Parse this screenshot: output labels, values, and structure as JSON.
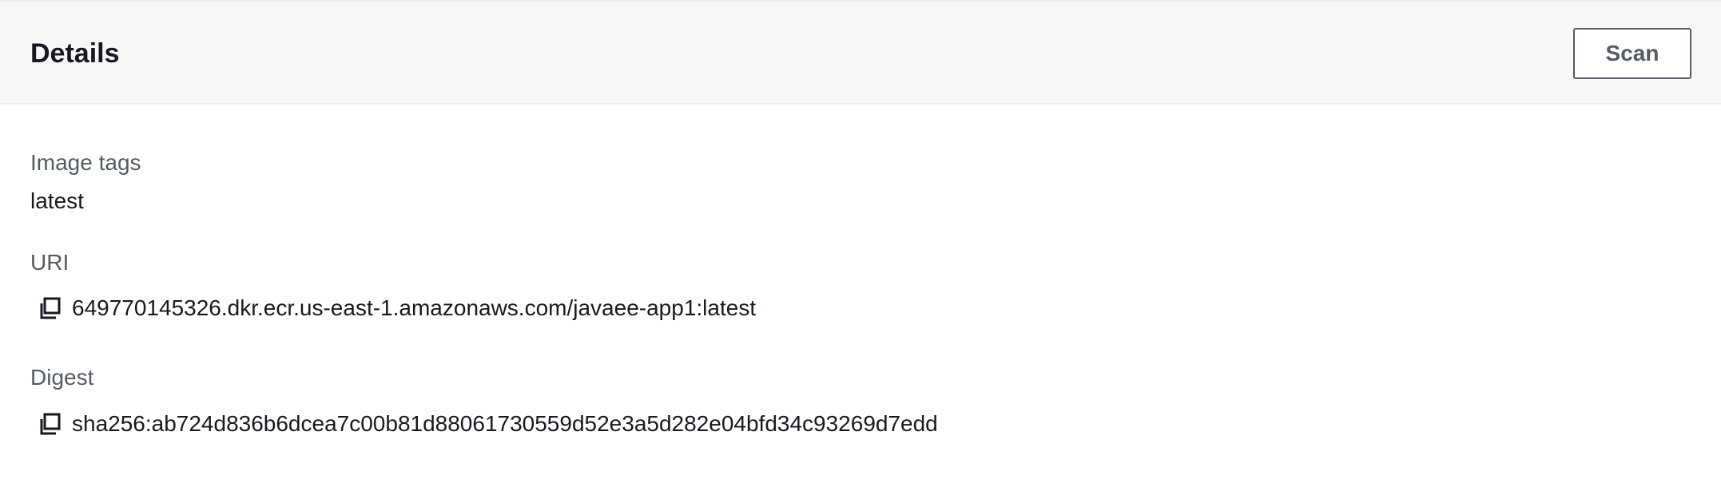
{
  "header": {
    "title": "Details",
    "scan_label": "Scan"
  },
  "details": {
    "image_tags": {
      "label": "Image tags",
      "value": "latest"
    },
    "uri": {
      "label": "URI",
      "value": "649770145326.dkr.ecr.us-east-1.amazonaws.com/javaee-app1:latest",
      "icon": "copy-icon"
    },
    "digest": {
      "label": "Digest",
      "value": "sha256:ab724d836b6dcea7c00b81d88061730559d52e3a5d282e04bfd34c93269d7edd",
      "icon": "copy-icon"
    }
  }
}
